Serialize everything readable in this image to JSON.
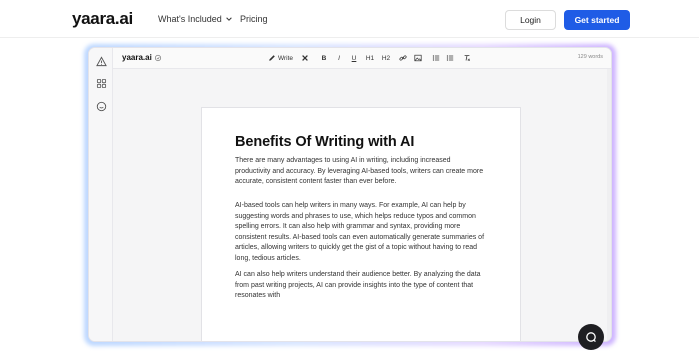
{
  "nav": {
    "logo": "yaara.ai",
    "whats_included": "What's Included",
    "pricing": "Pricing",
    "login": "Login",
    "get_started": "Get started",
    "primary_color": "#1f5ce6"
  },
  "editor": {
    "toolbar": {
      "logo": "yaara.ai",
      "write": "Write",
      "bold": "B",
      "italic": "I",
      "underline": "U",
      "h1": "H1",
      "h2": "H2",
      "word_count": "129 words"
    },
    "sidebar_icons": [
      "warning-icon",
      "grid-icon",
      "chat-icon"
    ],
    "document": {
      "title": "Benefits Of Writing with AI",
      "paragraphs": [
        "There are many advantages to using AI in writing, including increased productivity and accuracy. By leveraging AI-based tools, writers can create more accurate, consistent content faster than ever before.",
        "AI-based tools can help writers in many ways. For example, AI can help by suggesting words and phrases to use, which helps reduce typos and common spelling errors. It can also help with grammar and syntax, providing more consistent results. AI-based tools can even automatically generate summaries of articles, allowing writers to quickly get the gist of a topic without having to read long, tedious articles.",
        "AI can also help writers understand their audience better. By analyzing the data from past writing projects, AI can provide insights into the type of content that resonates with"
      ]
    }
  }
}
